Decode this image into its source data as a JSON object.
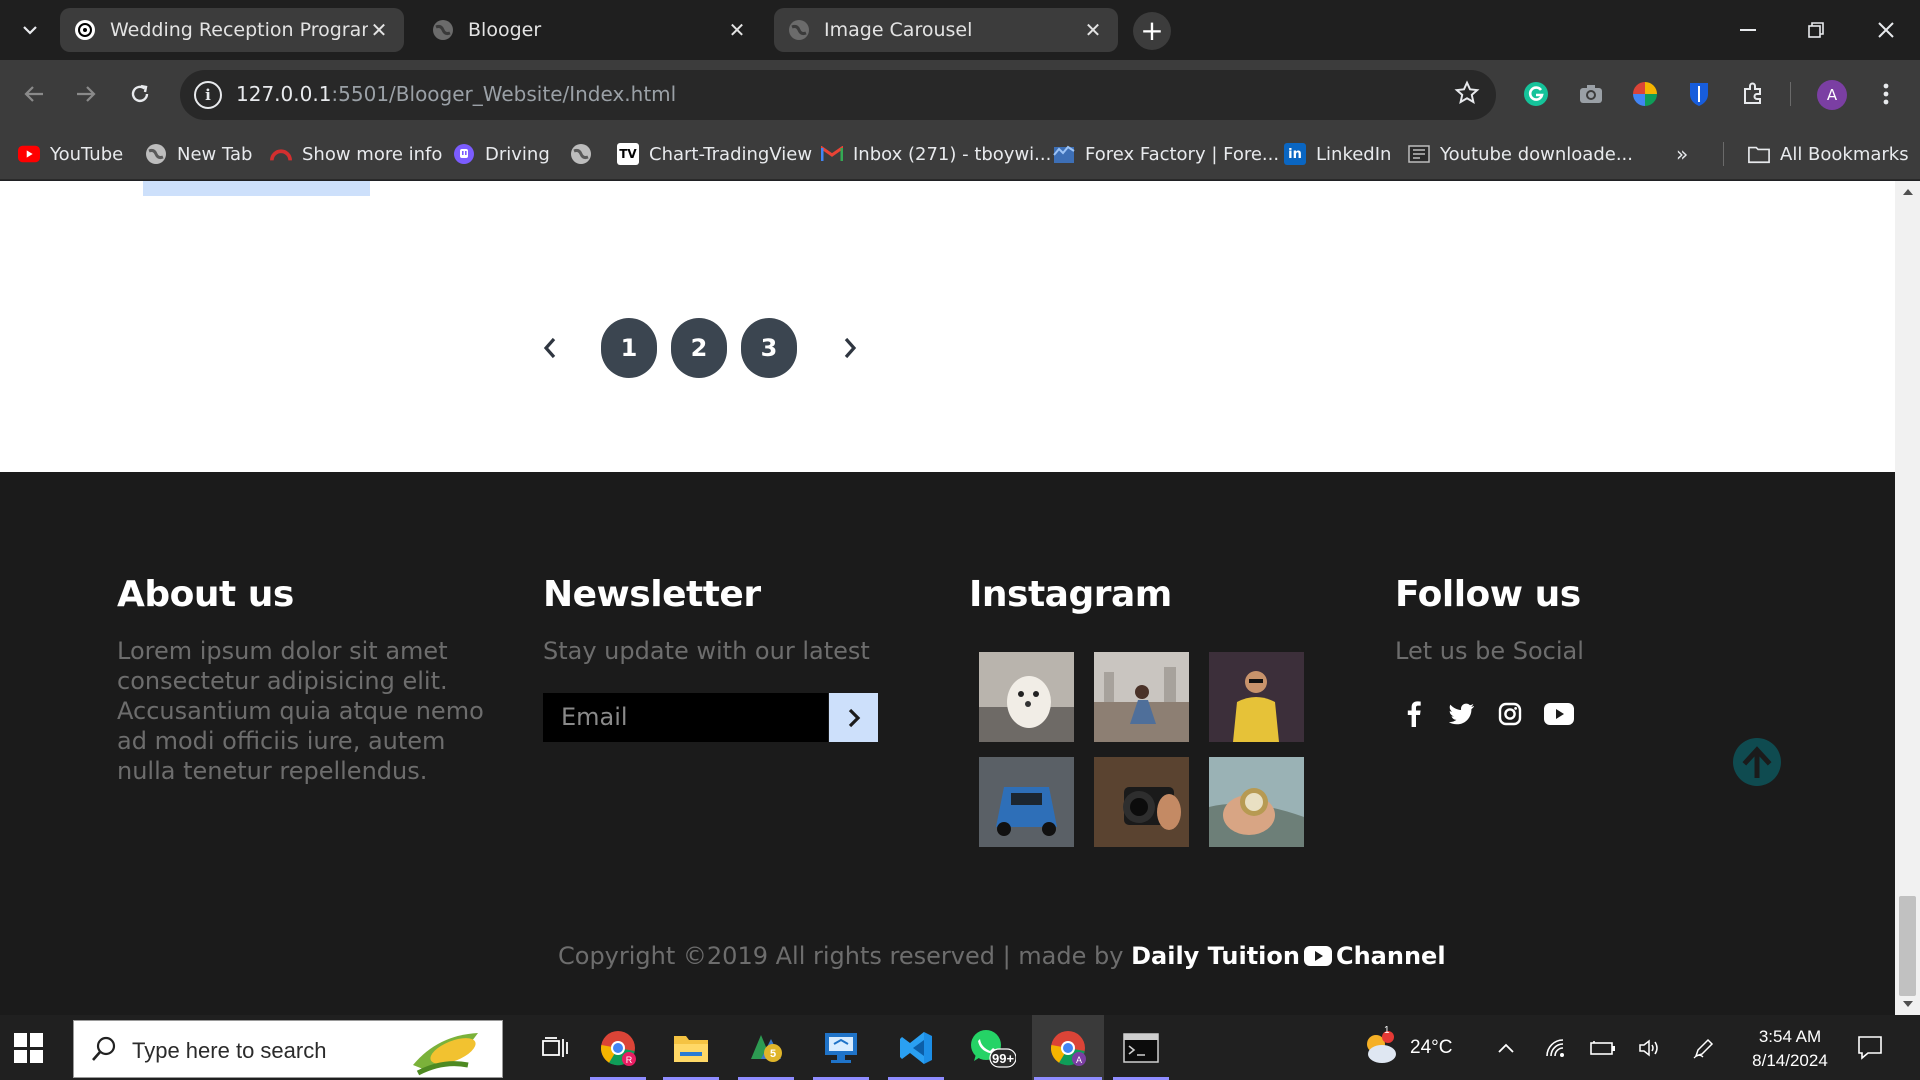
{
  "browser": {
    "tabs": [
      {
        "title": "Wedding Reception Program D",
        "active": true
      },
      {
        "title": "Blooger",
        "active": false
      },
      {
        "title": "Image Carousel",
        "active": true
      }
    ],
    "close_glyph": "✕",
    "new_tab_glyph": "+",
    "url_host": "127.0.0.1",
    "url_path": ":5501/Blooger_Website/Index.html",
    "bookmarks": [
      {
        "label": "YouTube",
        "icon": "youtube-icon"
      },
      {
        "label": "New Tab",
        "icon": "globe-icon"
      },
      {
        "label": "Show more info",
        "icon": "speedometer-icon"
      },
      {
        "label": "Driving",
        "icon": "twitch-icon"
      },
      {
        "label": "",
        "icon": "globe-icon"
      },
      {
        "label": "Chart-TradingView",
        "icon": "tradingview-icon"
      },
      {
        "label": "Inbox (271) - tboywi...",
        "icon": "gmail-icon"
      },
      {
        "label": "Forex Factory | Fore...",
        "icon": "forexfactory-icon"
      },
      {
        "label": "LinkedIn",
        "icon": "linkedin-icon"
      },
      {
        "label": "Youtube downloade...",
        "icon": "downloader-icon"
      }
    ],
    "bookmarks_more": "»",
    "all_bookmarks": "All Bookmarks",
    "profile_initial": "A"
  },
  "page": {
    "pagination": {
      "prev": "‹",
      "pages": [
        "1",
        "2",
        "3"
      ],
      "next": "›"
    },
    "footer": {
      "about": {
        "title": "About us",
        "text": "Lorem ipsum dolor sit amet consectetur adipisicing elit. Accusantium quia atque nemo ad modi officiis iure, autem nulla tenetur repellendus."
      },
      "newsletter": {
        "title": "Newsletter",
        "text": "Stay update with our latest",
        "email_placeholder": "Email",
        "send_glyph": "›"
      },
      "instagram": {
        "title": "Instagram",
        "images": [
          "dog-photo",
          "woman-city-photo",
          "man-yellow-sweater-photo",
          "blue-car-photo",
          "camera-photo",
          "compass-photo"
        ]
      },
      "follow": {
        "title": "Follow us",
        "text": "Let us be Social",
        "networks": [
          "facebook-icon",
          "twitter-icon",
          "instagram-icon",
          "youtube-icon"
        ]
      },
      "copyright": {
        "text": "Copyright ©2019 All rights reserved | made by ",
        "brand_a": "Daily Tuition",
        "brand_b": "Channel"
      }
    },
    "colors": {
      "footer_bg": "#1b1b1b",
      "accent_light_blue": "#cde0fb",
      "pagination_bg": "#3b4550",
      "back_to_top": "#0f4b50"
    }
  },
  "taskbar": {
    "search_placeholder": "Type here to search",
    "weather_temp": "24°C",
    "weather_badge": "1",
    "whatsapp_badge": "99+",
    "time": "3:54 AM",
    "date": "8/14/2024"
  }
}
